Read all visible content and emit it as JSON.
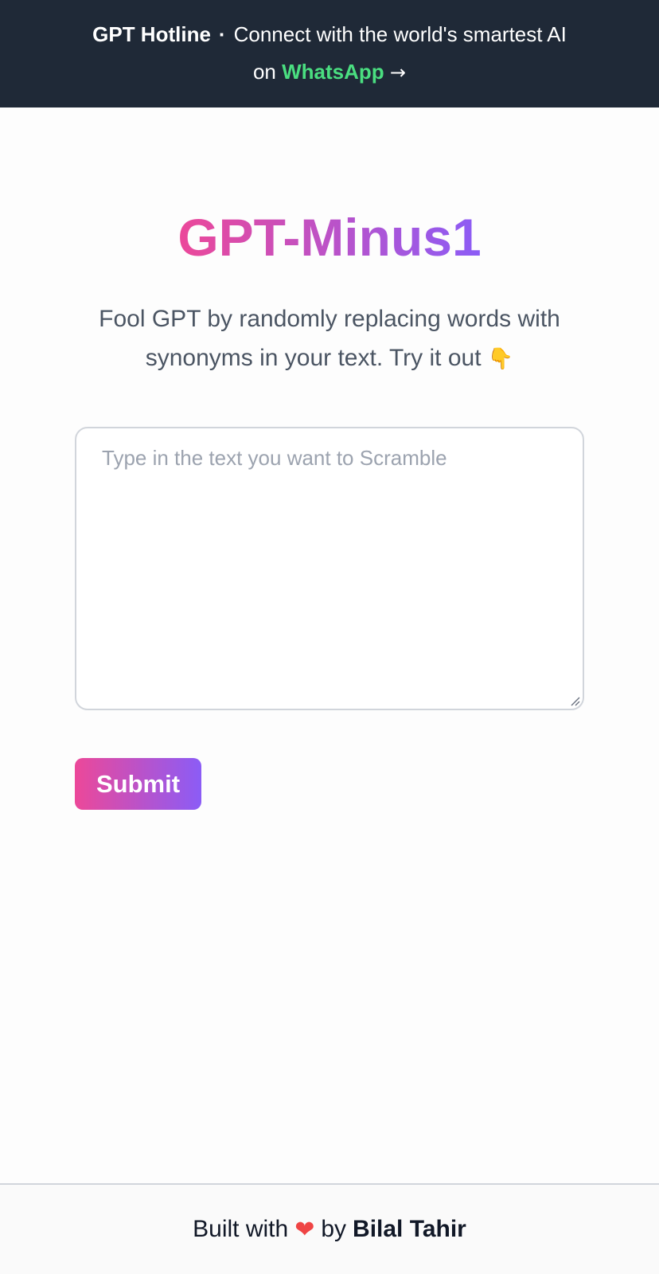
{
  "banner": {
    "brand": "GPT Hotline",
    "separator": "·",
    "tagline": "Connect with the world's smartest AI",
    "on": "on",
    "link_text": "WhatsApp",
    "arrow": "→"
  },
  "hero": {
    "title": "GPT-Minus1",
    "subtitle": "Fool GPT by randomly replacing words with synonyms in your text. Try it out",
    "pointer_emoji": "👇"
  },
  "form": {
    "textarea_placeholder": "Type in the text you want to Scramble",
    "textarea_value": "",
    "submit_label": "Submit"
  },
  "footer": {
    "built_with": "Built with",
    "heart": "❤",
    "by": "by",
    "author": "Bilal Tahir"
  },
  "colors": {
    "banner_bg": "#1f2937",
    "accent_green": "#4ade80",
    "gradient_start": "#ec4899",
    "gradient_end": "#8b5cf6"
  }
}
